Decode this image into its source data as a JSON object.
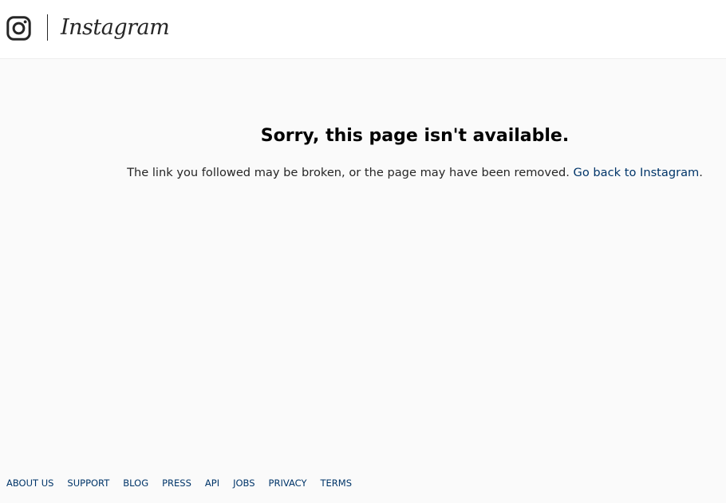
{
  "header": {
    "logo_icon": "instagram-camera-icon",
    "wordmark": "Instagram"
  },
  "error": {
    "title": "Sorry, this page isn't available.",
    "message": "The link you followed may be broken, or the page may have been removed.",
    "link_text": "Go back to Instagram",
    "trailing": "."
  },
  "footer": {
    "links": [
      "ABOUT US",
      "SUPPORT",
      "BLOG",
      "PRESS",
      "API",
      "JOBS",
      "PRIVACY",
      "TERMS"
    ]
  },
  "colors": {
    "page_background": "#fafafa",
    "header_background": "#ffffff",
    "text": "#262626",
    "link": "#003569"
  }
}
